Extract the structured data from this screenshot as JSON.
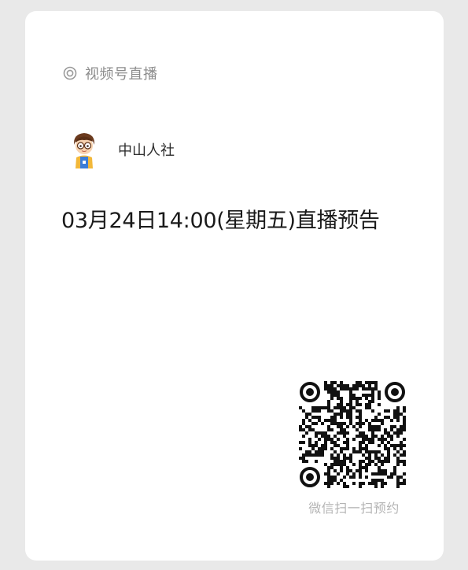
{
  "card": {
    "header_label": "视频号直播",
    "account_name": "中山人社",
    "live_title": "03月24日14:00(星期五)直播预告",
    "qr_caption": "微信扫一扫预约"
  },
  "icons": {
    "live": "live-broadcast-icon",
    "avatar": "cartoon-avatar",
    "qr": "qr-code"
  },
  "colors": {
    "background": "#e9e9e9",
    "card": "#ffffff",
    "header_text": "#8c8c8c",
    "caption_text": "#b4b4b4"
  }
}
